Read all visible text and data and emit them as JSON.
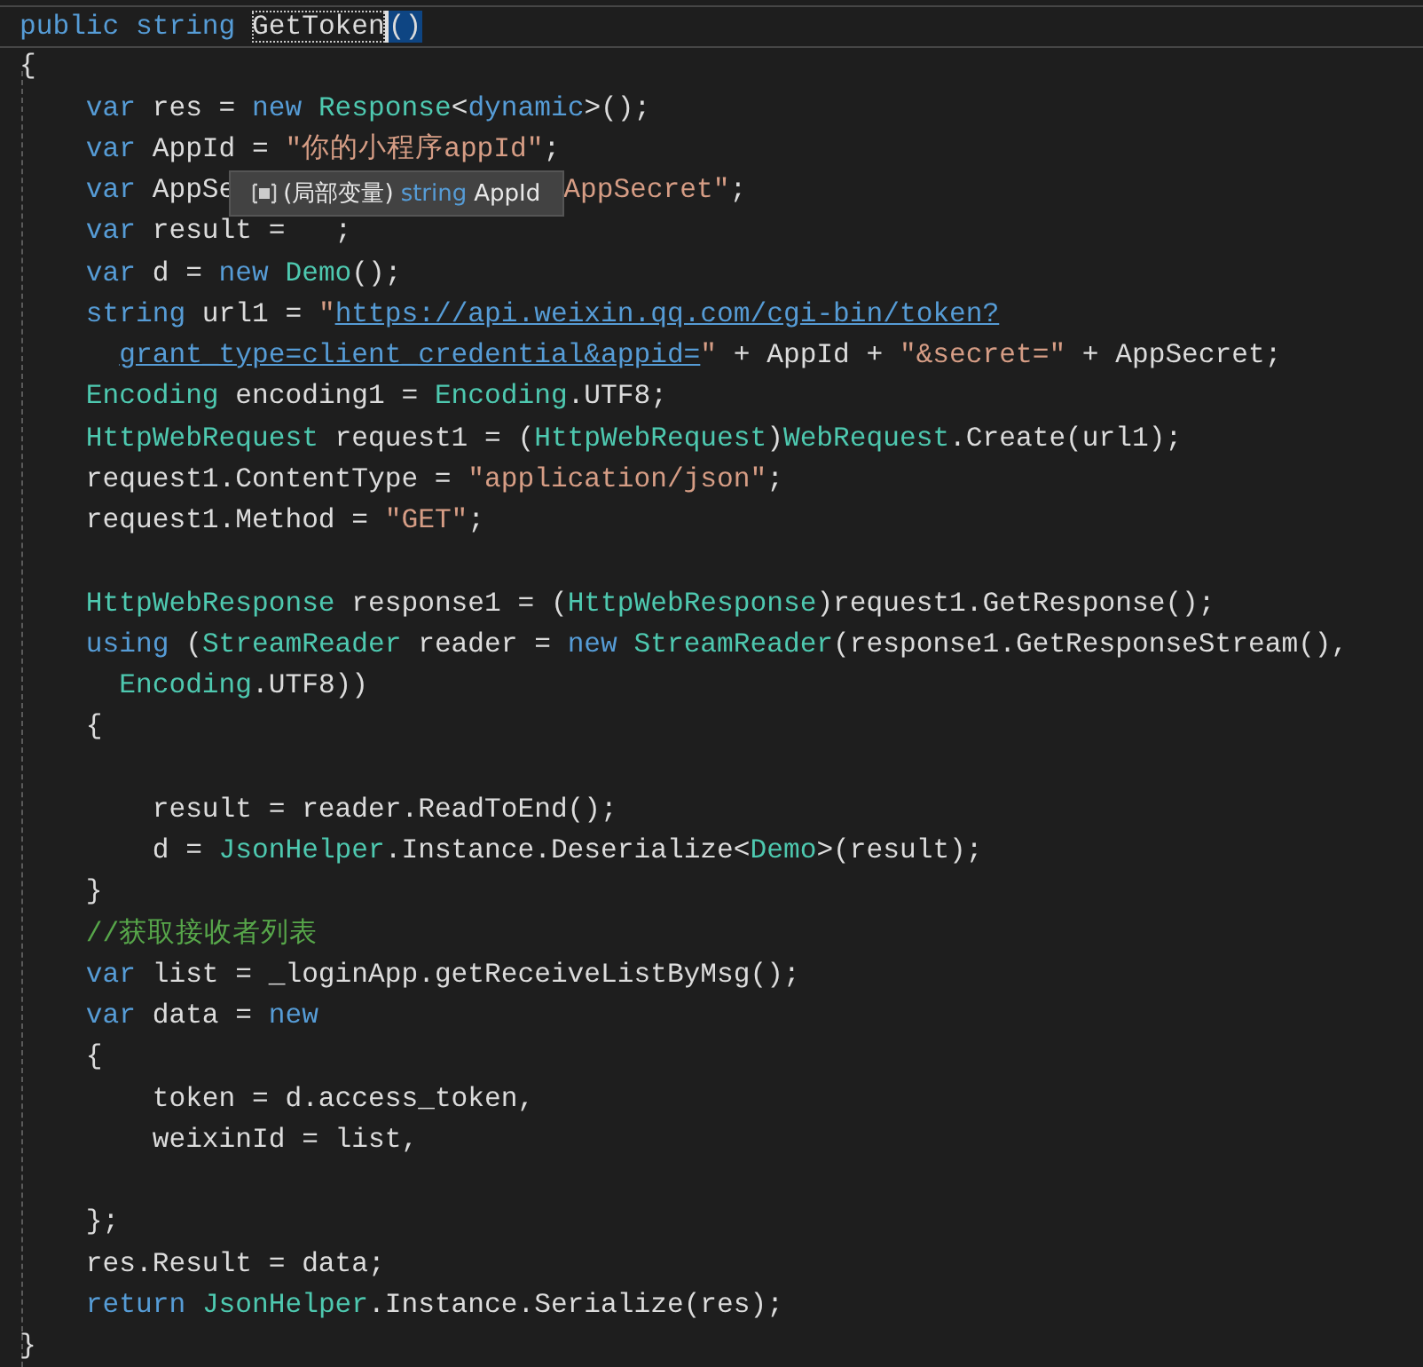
{
  "editor": {
    "lines": [
      {
        "current": true,
        "tokens": [
          {
            "kind": "kw",
            "text": "public string "
          },
          {
            "kind": "sel",
            "text": "GetToken"
          },
          {
            "kind": "brace",
            "text": "()"
          }
        ]
      },
      {
        "current": false,
        "tokens": [
          {
            "kind": "id",
            "text": "{"
          }
        ]
      },
      {
        "current": false,
        "kind": "block",
        "tokens": [
          {
            "kind": "kw",
            "text": "var"
          },
          {
            "kind": "id",
            "text": " res = "
          },
          {
            "kind": "kw",
            "text": "new "
          },
          {
            "kind": "type",
            "text": "Response"
          },
          {
            "kind": "id",
            "text": "<"
          },
          {
            "kind": "kw",
            "text": "dynamic"
          },
          {
            "kind": "id",
            "text": ">();"
          }
        ]
      },
      {
        "current": false,
        "kind": "block",
        "tokens": [
          {
            "kind": "kw",
            "text": "var"
          },
          {
            "kind": "id",
            "text": " AppId = "
          },
          {
            "kind": "str",
            "text": "\"你的小程序appId\""
          },
          {
            "kind": "id",
            "text": ";"
          }
        ]
      },
      {
        "current": false,
        "kind": "block",
        "tokens": [
          {
            "kind": "kw",
            "text": "var"
          },
          {
            "kind": "id",
            "text": " AppSe"
          },
          {
            "kind": "tooltip",
            "scope": "(局部变量)",
            "type": "string",
            "name": "AppId"
          },
          {
            "kind": "str",
            "text": "AppSecret\""
          },
          {
            "kind": "id",
            "text": ";"
          }
        ]
      },
      {
        "current": false,
        "kind": "block",
        "tokens": [
          {
            "kind": "kw",
            "text": "var"
          },
          {
            "kind": "id",
            "text": " result =   ;"
          }
        ]
      },
      {
        "current": false,
        "kind": "block",
        "tokens": [
          {
            "kind": "kw",
            "text": "var"
          },
          {
            "kind": "id",
            "text": " d = "
          },
          {
            "kind": "kw",
            "text": "new "
          },
          {
            "kind": "type",
            "text": "Demo"
          },
          {
            "kind": "id",
            "text": "();"
          }
        ]
      },
      {
        "current": false,
        "kind": "block",
        "tokens": [
          {
            "kind": "kw",
            "text": "string"
          },
          {
            "kind": "id",
            "text": " url1 = "
          },
          {
            "kind": "str",
            "text": "\""
          },
          {
            "kind": "url",
            "text": "https://api.weixin.qq.com/cgi-bin/token?"
          }
        ]
      },
      {
        "current": false,
        "kind": "continuation",
        "tokens": [
          {
            "kind": "url",
            "text": "grant_type=client_credential&appid="
          },
          {
            "kind": "str",
            "text": "\""
          },
          {
            "kind": "id",
            "text": " + AppId + "
          },
          {
            "kind": "str",
            "text": "\"&secret=\""
          },
          {
            "kind": "id",
            "text": " + AppSecret;"
          }
        ]
      },
      {
        "current": false,
        "kind": "block",
        "tokens": [
          {
            "kind": "type",
            "text": "Encoding"
          },
          {
            "kind": "id",
            "text": " encoding1 = "
          },
          {
            "kind": "type",
            "text": "Encoding"
          },
          {
            "kind": "id",
            "text": ".UTF8;"
          }
        ]
      },
      {
        "current": false,
        "kind": "block",
        "tokens": [
          {
            "kind": "type",
            "text": "HttpWebRequest"
          },
          {
            "kind": "id",
            "text": " request1 = ("
          },
          {
            "kind": "type",
            "text": "HttpWebRequest"
          },
          {
            "kind": "id",
            "text": ")"
          },
          {
            "kind": "type",
            "text": "WebRequest"
          },
          {
            "kind": "id",
            "text": ".Create(url1);"
          }
        ]
      },
      {
        "current": false,
        "kind": "block",
        "tokens": [
          {
            "kind": "id",
            "text": "request1.ContentType = "
          },
          {
            "kind": "str",
            "text": "\"application/json\""
          },
          {
            "kind": "id",
            "text": ";"
          }
        ]
      },
      {
        "current": false,
        "kind": "block",
        "tokens": [
          {
            "kind": "id",
            "text": "request1.Method = "
          },
          {
            "kind": "str",
            "text": "\"GET\""
          },
          {
            "kind": "id",
            "text": ";"
          }
        ]
      },
      {
        "current": false
      },
      {
        "current": false,
        "kind": "block",
        "tokens": [
          {
            "kind": "type",
            "text": "HttpWebResponse"
          },
          {
            "kind": "id",
            "text": " response1 = ("
          },
          {
            "kind": "type",
            "text": "HttpWebResponse"
          },
          {
            "kind": "id",
            "text": ")request1.GetResponse();"
          }
        ]
      },
      {
        "current": false,
        "kind": "block",
        "tokens": [
          {
            "kind": "kw",
            "text": "using"
          },
          {
            "kind": "id",
            "text": " ("
          },
          {
            "kind": "type",
            "text": "StreamReader"
          },
          {
            "kind": "id",
            "text": " reader = "
          },
          {
            "kind": "kw",
            "text": "new "
          },
          {
            "kind": "type",
            "text": "StreamReader"
          },
          {
            "kind": "id",
            "text": "(response1.GetResponseStream(),"
          }
        ]
      },
      {
        "current": false,
        "kind": "continuation",
        "tokens": [
          {
            "kind": "type",
            "text": "Encoding"
          },
          {
            "kind": "id",
            "text": ".UTF8))"
          }
        ]
      },
      {
        "current": false,
        "kind": "block",
        "tokens": [
          {
            "kind": "id",
            "text": "{"
          }
        ]
      },
      {
        "current": false
      },
      {
        "current": false,
        "kind": "nested",
        "tokens": [
          {
            "kind": "id",
            "text": "result = reader.ReadToEnd();"
          }
        ]
      },
      {
        "current": false,
        "kind": "nested",
        "tokens": [
          {
            "kind": "id",
            "text": "d = "
          },
          {
            "kind": "type",
            "text": "JsonHelper"
          },
          {
            "kind": "id",
            "text": ".Instance.Deserialize<"
          },
          {
            "kind": "type",
            "text": "Demo"
          },
          {
            "kind": "id",
            "text": ">(result);"
          }
        ]
      },
      {
        "current": false,
        "kind": "block",
        "tokens": [
          {
            "kind": "id",
            "text": "}"
          }
        ]
      },
      {
        "current": false,
        "kind": "block",
        "tokens": [
          {
            "kind": "cmt",
            "text": "//获取接收者列表"
          }
        ]
      },
      {
        "current": false,
        "kind": "block",
        "tokens": [
          {
            "kind": "kw",
            "text": "var"
          },
          {
            "kind": "id",
            "text": " list = _loginApp.getReceiveListByMsg();"
          }
        ]
      },
      {
        "current": false,
        "kind": "block",
        "tokens": [
          {
            "kind": "kw",
            "text": "var"
          },
          {
            "kind": "id",
            "text": " data = "
          },
          {
            "kind": "kw",
            "text": "new"
          }
        ]
      },
      {
        "current": false,
        "kind": "block",
        "tokens": [
          {
            "kind": "id",
            "text": "{"
          }
        ]
      },
      {
        "current": false,
        "kind": "nested",
        "tokens": [
          {
            "kind": "id",
            "text": "token = d.access_token,"
          }
        ]
      },
      {
        "current": false,
        "kind": "nested",
        "tokens": [
          {
            "kind": "id",
            "text": "weixinId = list,"
          }
        ]
      },
      {
        "current": false
      },
      {
        "current": false,
        "kind": "block",
        "tokens": [
          {
            "kind": "id",
            "text": "};"
          }
        ]
      },
      {
        "current": false,
        "kind": "block",
        "tokens": [
          {
            "kind": "id",
            "text": "res.Result = data;"
          }
        ]
      },
      {
        "current": false,
        "kind": "block",
        "tokens": [
          {
            "kind": "kw",
            "text": "return "
          },
          {
            "kind": "type",
            "text": "JsonHelper"
          },
          {
            "kind": "id",
            "text": ".Instance.Serialize(res);"
          }
        ]
      },
      {
        "current": false,
        "tokens": [
          {
            "kind": "id",
            "text": "}"
          }
        ]
      }
    ]
  }
}
